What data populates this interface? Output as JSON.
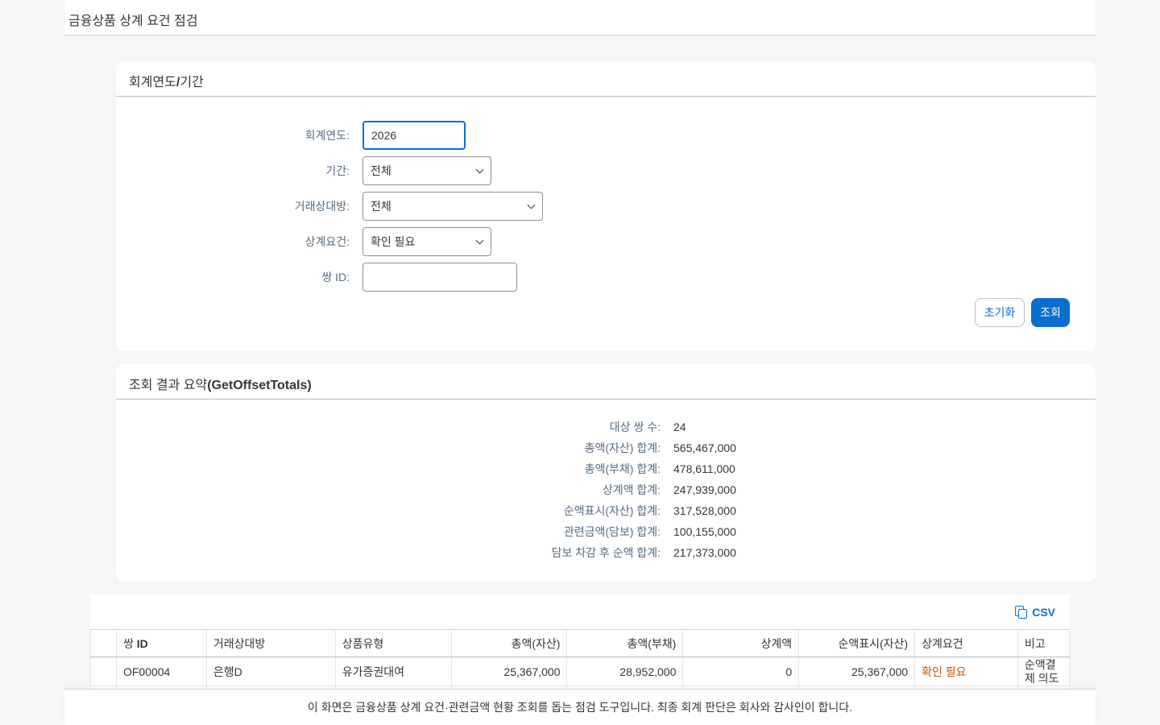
{
  "app": {
    "title": "금융상품 상계 요건 점검"
  },
  "filter_panel": {
    "title_a": "회계연도",
    "title_sep": "/",
    "title_b": "기간",
    "fiscal_year_label": "회계연도:",
    "fiscal_year_value": "2026",
    "period_label": "기간:",
    "period_value": "전체",
    "counterparty_label": "거래상대방:",
    "counterparty_value": "전체",
    "offset_req_label": "상계요건:",
    "offset_req_value": "확인 필요",
    "pair_id_label": "쌍 ID:",
    "pair_id_value": "",
    "reset_label": "초기화",
    "search_label": "조회"
  },
  "summary_panel": {
    "title_a": "조회 결과 요약",
    "title_b": "(GetOffsetTotals)",
    "rows": [
      {
        "k": "대상 쌍 수:",
        "v": "24"
      },
      {
        "k": "총액(자산) 합계:",
        "v": "565,467,000"
      },
      {
        "k": "총액(부채) 합계:",
        "v": "478,611,000"
      },
      {
        "k": "상계액 합계:",
        "v": "247,939,000"
      },
      {
        "k": "순액표시(자산) 합계:",
        "v": "317,528,000"
      },
      {
        "k": "관련금액(담보) 합계:",
        "v": "100,155,000"
      },
      {
        "k": "담보 차감 후 순액 합계:",
        "v": "217,373,000"
      }
    ]
  },
  "table": {
    "csv_label": "CSV",
    "headers": {
      "pair_id_a": "쌍 ",
      "pair_id_b": "ID",
      "counterparty": "거래상대방",
      "product": "상품유형",
      "gross_asset": "총액(자산)",
      "gross_liab": "총액(부채)",
      "offset": "상계액",
      "net_asset": "순액표시(자산)",
      "req": "상계요건",
      "note": "비고"
    },
    "rows": [
      {
        "pair_id": "OF00004",
        "counterparty": "은행D",
        "product": "유가증권대여",
        "gross_asset": "25,367,000",
        "gross_liab": "28,952,000",
        "offset": "0",
        "net_asset": "25,367,000",
        "req": "확인 필요",
        "note": "순액결제 의도"
      }
    ]
  },
  "footer": {
    "text": "이 화면은 금융상품 상계 요건·관련금액 현황 조회를 돕는 점검 도구입니다. 최종 회계 판단은 회사와 감사인이 합니다."
  }
}
